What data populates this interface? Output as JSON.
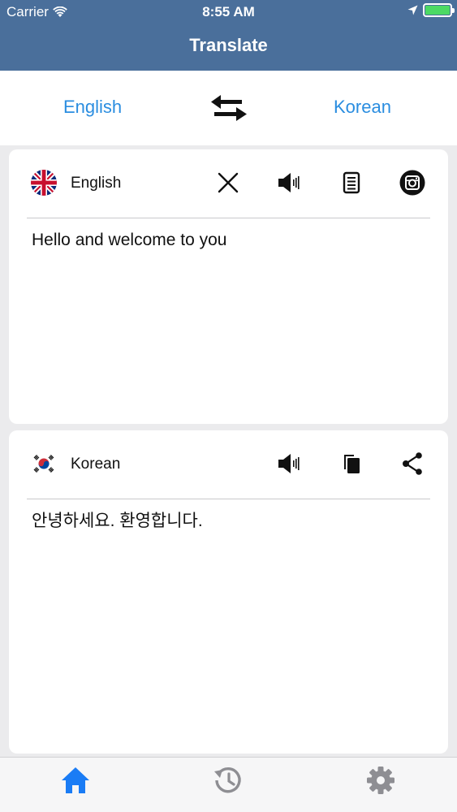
{
  "status_bar": {
    "carrier": "Carrier",
    "time": "8:55 AM",
    "battery_level": 1.0,
    "battery_color": "#4cd964"
  },
  "header": {
    "title": "Translate",
    "background_color": "#4a6f9b"
  },
  "language_bar": {
    "source_language": "English",
    "target_language": "Korean",
    "swap_icon": "swap-arrows-icon",
    "link_color": "#2a8de0"
  },
  "source_card": {
    "flag_icon": "uk-flag-icon",
    "language": "English",
    "actions": [
      "close-icon",
      "speaker-icon",
      "document-icon",
      "instagram-icon"
    ],
    "text": "Hello and welcome to you"
  },
  "target_card": {
    "flag_icon": "korea-flag-icon",
    "language": "Korean",
    "actions": [
      "speaker-icon",
      "copy-icon",
      "share-icon"
    ],
    "text": "안녕하세요. 환영합니다."
  },
  "tab_bar": {
    "tabs": [
      {
        "icon": "home-icon",
        "active": true
      },
      {
        "icon": "history-icon",
        "active": false
      },
      {
        "icon": "settings-gear-icon",
        "active": false
      }
    ],
    "active_color": "#1a7cf5",
    "inactive_color": "#8e8e93"
  }
}
